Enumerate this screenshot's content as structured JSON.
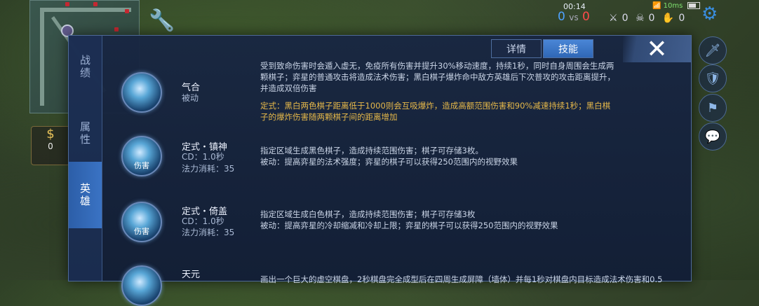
{
  "hud": {
    "timer": "00:14",
    "score_blue": "0",
    "score_vs": "vs",
    "score_red": "0",
    "kills": "0",
    "deaths": "0",
    "assists": "0",
    "wifi_speed": "10ms",
    "gold": "0",
    "icons": [
      "minimap",
      "wrench-icon",
      "gear-icon",
      "sword-icon",
      "shield-icon",
      "flag-icon",
      "chat-icon",
      "money-bag-icon"
    ]
  },
  "panel": {
    "side_tabs": [
      "战绩",
      "属性",
      "英雄"
    ],
    "active_side_tab": "英雄",
    "top_tabs": [
      "详情",
      "技能"
    ],
    "active_top_tab": "技能",
    "close_label": "✕",
    "skills": [
      {
        "name": "气合",
        "sub1": "被动",
        "sub2": "",
        "icon_text": "",
        "desc": "受到致命伤害时会遁入虚无，免疫所有伤害并提升30%移动速度，持续1秒，同时自身周围会生成两颗棋子；弈星的普通攻击将造成法术伤害；黑白棋子爆炸命中敌方英雄后下次普攻的攻击距离提升，并造成双倍伤害",
        "desc_gold": "定式：黑白两色棋子距离低于1000则会互吸爆炸，造成高额范围伤害和90%减速持续1秒；黑白棋子的爆炸伤害随两颗棋子间的距离增加"
      },
      {
        "name": "定式・镇神",
        "sub1": "CD：1.0秒",
        "sub2": "法力消耗：35",
        "icon_text": "伤害",
        "desc": "指定区域生成黑色棋子，造成持续范围伤害；棋子可存储3枚。\n被动：提高弈星的法术强度；弈星的棋子可以获得250范围内的视野效果",
        "desc_gold": ""
      },
      {
        "name": "定式・倚盖",
        "sub1": "CD：1.0秒",
        "sub2": "法力消耗：35",
        "icon_text": "伤害",
        "desc": "指定区域生成白色棋子，造成持续范围伤害；棋子可存储3枚\n被动：提高弈星的冷却缩减和冷却上限；弈星的棋子可以获得250范围内的视野效果",
        "desc_gold": ""
      },
      {
        "name": "天元",
        "sub1": "",
        "sub2": "",
        "icon_text": "",
        "desc": "画出一个巨大的虚空棋盘，2秒棋盘完全成型后在四周生成屏障（墙体）并每1秒对棋盘内目标造成法术伤害和0.5",
        "desc_gold": ""
      }
    ]
  }
}
